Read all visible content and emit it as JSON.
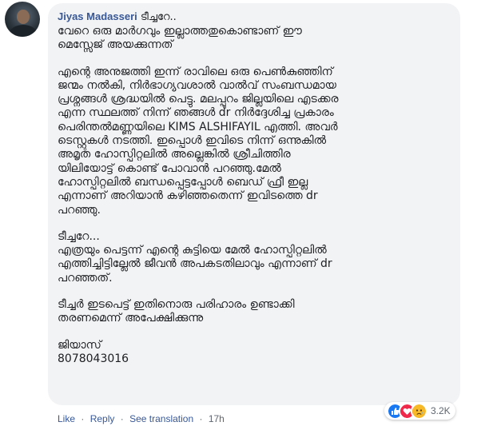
{
  "comment": {
    "author": "Jiyas Madasseri",
    "greeting": "ടീച്ചറേ..",
    "paragraphs": [
      "വേറെ ഒരു മാർഗവും ഇല്ലാത്തതുകൊണ്ടാണ് ഈ\nമെസ്സേജ് അയക്കുന്നത്",
      "എന്റെ അനുജത്തി ഇന്ന് രാവിലെ ഒരു പെൺകുഞ്ഞിന്\nജന്മം നൽകി, നിർഭാഗ്യവശാൽ വാൽവ് സംബന്ധമായ\nപ്രശ്നങ്ങൾ ശ്രദ്ധയിൽ പെട്ടു. മലപ്പുറം ജില്ലയിലെ എടക്കര\nഎന്ന സ്ഥലത്ത് നിന്ന് ഞങ്ങൾ dr നിർദ്ദേശിച്ച പ്രകാരം\nപെരിന്തൽമണ്ണയിലെ KIMS ALSHIFAYIL എത്തി. അവർ\nടെസ്റ്റുകൾ നടത്തി. ഇപ്പൊൾ ഇവിടെ നിന്ന് ഒന്നുകിൽ\nഅമൃത ഹോസ്പിറ്റലിൽ അല്ലെങ്കിൽ ശ്രീചിത്തിര\nയിലിയോട്ട് കൊണ്ട് പോവാൻ പറഞ്ഞു.മേൽ\nഹോസ്പിറ്റലിൽ ബന്ധപ്പെട്ടപ്പോൾ ബെഡ് ഫ്രീ ഇല്ല\nഎന്നാണ് അറിയാൻ കഴിഞ്ഞതെന്ന് ഇവിടത്തെ dr\nപറഞ്ഞു.",
      "ടീച്ചറേ...\nഎത്രയും പെട്ടന്ന് എന്റെ കുട്ടിയെ മേൽ ഹോസ്പിറ്റലിൽ\nഎത്തിച്ചിട്ടില്ലേൽ ജീവൻ അപകടതിലാവും എന്നാണ് dr\nപറഞ്ഞത്.",
      "ടീച്ചർ ഇടപെട്ട് ഇതിനൊരു പരിഹാരം ഉണ്ടാക്കി\nതരണമെന്ന് അപേക്ഷിക്കുന്നു",
      "ജിയാസ്\n8078043016"
    ]
  },
  "actions": {
    "like": "Like",
    "reply": "Reply",
    "see_translation": "See translation",
    "time": "17h",
    "separator": "·"
  },
  "reactions": {
    "types": [
      "like",
      "love",
      "sad"
    ],
    "colors": {
      "like": "#1877f2",
      "love": "#f0284a",
      "sad": "#f7b928"
    },
    "count": "3.2K"
  }
}
